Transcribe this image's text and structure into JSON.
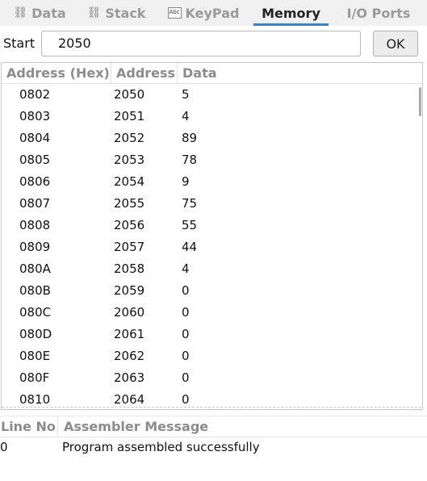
{
  "tabs": [
    {
      "label": "Data",
      "icon": "link-icon",
      "active": false
    },
    {
      "label": "Stack",
      "icon": "link-icon",
      "active": false
    },
    {
      "label": "KeyPad",
      "icon": "abc-keypad-icon",
      "active": false
    },
    {
      "label": "Memory",
      "icon": "",
      "active": true
    },
    {
      "label": "I/O Ports",
      "icon": "",
      "active": false
    }
  ],
  "start": {
    "label": "Start",
    "value": "2050",
    "ok_label": "OK"
  },
  "memory_table": {
    "columns": [
      "Address (Hex)",
      "Address",
      "Data"
    ],
    "rows": [
      [
        "0802",
        "2050",
        "5"
      ],
      [
        "0803",
        "2051",
        "4"
      ],
      [
        "0804",
        "2052",
        "89"
      ],
      [
        "0805",
        "2053",
        "78"
      ],
      [
        "0806",
        "2054",
        "9"
      ],
      [
        "0807",
        "2055",
        "75"
      ],
      [
        "0808",
        "2056",
        "55"
      ],
      [
        "0809",
        "2057",
        "44"
      ],
      [
        "080A",
        "2058",
        "4"
      ],
      [
        "080B",
        "2059",
        "0"
      ],
      [
        "080C",
        "2060",
        "0"
      ],
      [
        "080D",
        "2061",
        "0"
      ],
      [
        "080E",
        "2062",
        "0"
      ],
      [
        "080F",
        "2063",
        "0"
      ],
      [
        "0810",
        "2064",
        "0"
      ]
    ]
  },
  "assembler": {
    "columns": [
      "Line No",
      "Assembler Message"
    ],
    "rows": [
      [
        "0",
        "Program assembled successfully"
      ]
    ]
  },
  "colors": {
    "active_tab_underline": "#3b7fc4",
    "header_text": "#8c8c8c"
  }
}
